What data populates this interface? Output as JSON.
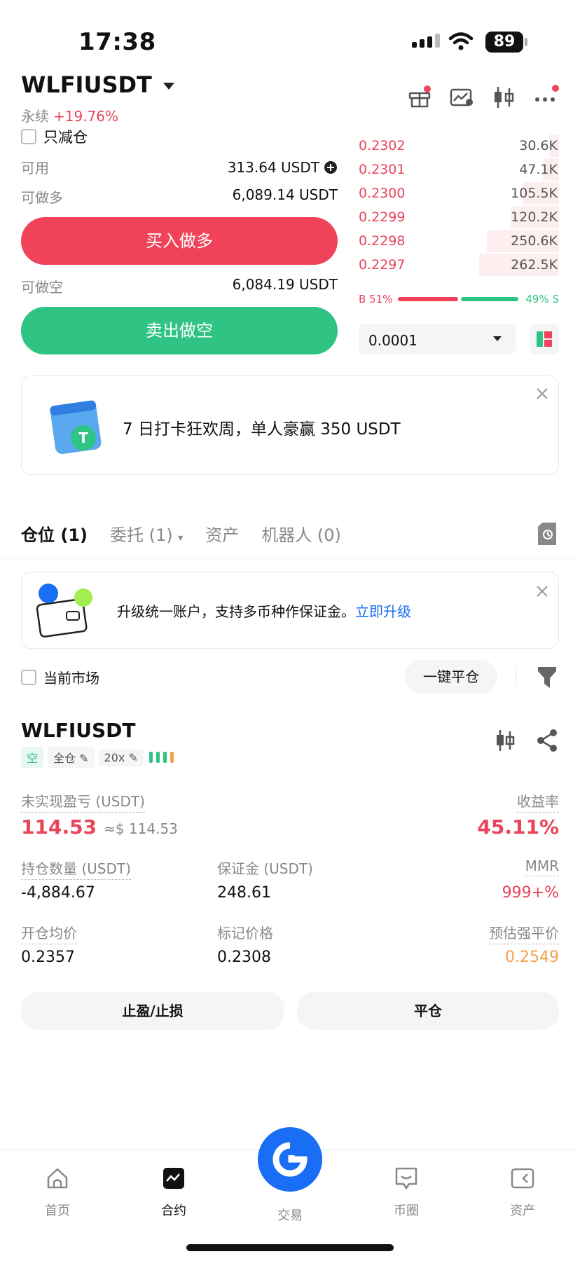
{
  "status": {
    "time": "17:38",
    "battery": "89"
  },
  "header": {
    "symbol": "WLFIUSDT",
    "type": "永续",
    "change": "+19.76%"
  },
  "reduce_only": {
    "label": "只减仓"
  },
  "balances": {
    "available_label": "可用",
    "available_value": "313.64 USDT",
    "long_label": "可做多",
    "long_value": "6,089.14 USDT",
    "short_label": "可做空",
    "short_value": "6,084.19 USDT"
  },
  "buttons": {
    "buy": "买入做多",
    "sell": "卖出做空"
  },
  "orderbook": {
    "rows": [
      {
        "price": "0.2302",
        "qty": "30.6K",
        "depth": 0.05
      },
      {
        "price": "0.2301",
        "qty": "47.1K",
        "depth": 0.08
      },
      {
        "price": "0.2300",
        "qty": "105.5K",
        "depth": 0.18
      },
      {
        "price": "0.2299",
        "qty": "120.2K",
        "depth": 0.24
      },
      {
        "price": "0.2298",
        "qty": "250.6K",
        "depth": 0.36
      },
      {
        "price": "0.2297",
        "qty": "262.5K",
        "depth": 0.4
      }
    ],
    "buy_ratio": "B 51%",
    "sell_ratio": "49% S",
    "buy_fraction": 0.51,
    "precision": "0.0001"
  },
  "promo": {
    "text": "7 日打卡狂欢周，单人豪赢 350 USDT"
  },
  "tabs": [
    {
      "label": "仓位 (1)"
    },
    {
      "label": "委托 (1)"
    },
    {
      "label": "资产"
    },
    {
      "label": "机器人 (0)"
    }
  ],
  "upgrade": {
    "text": "升级统一账户，支持多币种作保证金。",
    "link": "立即升级"
  },
  "filter": {
    "current_market": "当前市场",
    "close_all": "一键平仓"
  },
  "position": {
    "symbol": "WLFIUSDT",
    "side": "空",
    "margin_mode": "全仓",
    "leverage": "20x",
    "pnl_label": "未实现盈亏 (USDT)",
    "pnl_value": "114.53",
    "pnl_usd": "≈$ 114.53",
    "roe_label": "收益率",
    "roe_value": "45.11%",
    "size_label": "持仓数量 (USDT)",
    "size_value": "-4,884.67",
    "margin_label": "保证金 (USDT)",
    "margin_value": "248.61",
    "mmr_label": "MMR",
    "mmr_value": "999+%",
    "entry_label": "开仓均价",
    "entry_value": "0.2357",
    "mark_label": "标记价格",
    "mark_value": "0.2308",
    "liq_label": "预估强平价",
    "liq_value": "0.2549",
    "tpsl_btn": "止盈/止损",
    "close_btn": "平仓"
  },
  "nav": [
    {
      "label": "首页"
    },
    {
      "label": "合约"
    },
    {
      "label": "交易"
    },
    {
      "label": "币圈"
    },
    {
      "label": "资产"
    }
  ],
  "colors": {
    "red": "#f0435a",
    "green": "#2fc384",
    "blue": "#1a6ef5",
    "orange": "#f5a04a"
  }
}
